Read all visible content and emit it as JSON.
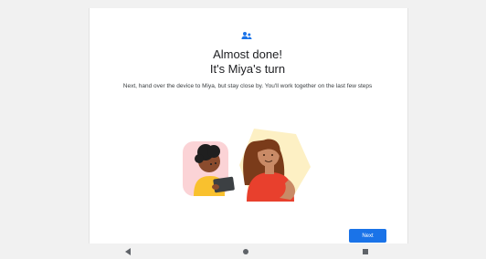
{
  "setup": {
    "icon": "supervised-user-icon",
    "title_line1": "Almost done!",
    "title_line2": "It's Miya's turn",
    "description": "Next, hand over the device to Miya, but stay close by. You'll work together on the last few steps",
    "next_label": "Next"
  },
  "navigation_bar": {
    "back_icon": "back-triangle-icon",
    "home_icon": "home-circle-icon",
    "recents_icon": "recents-square-icon"
  },
  "colors": {
    "accent": "#1a73e8",
    "background": "#ffffff",
    "page_background": "#f1f1f1"
  }
}
